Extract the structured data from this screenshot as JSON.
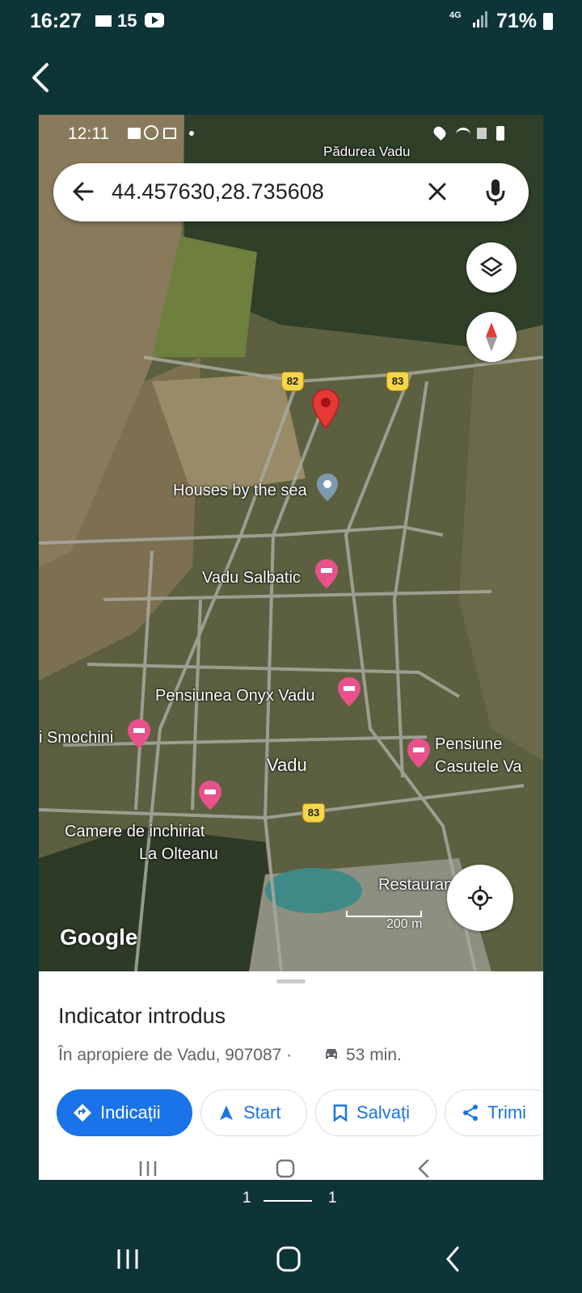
{
  "outer_status": {
    "time": "16:27",
    "temp": "15",
    "network": "4G",
    "battery": "71%"
  },
  "inner_status": {
    "time": "12:11"
  },
  "search": {
    "query": "44.457630,28.735608"
  },
  "map": {
    "labels": {
      "forest": "Pădurea Vadu",
      "houses": "Houses by the sea",
      "salbatic": "Vadu Salbatic",
      "onyx": "Pensiunea Onyx Vadu",
      "smochini": "i Smochini",
      "vadu": "Vadu",
      "casutele_1": "Pensiune",
      "casutele_2": "Casutele Va",
      "camere_1": "Camere de inchiriat",
      "camere_2": "La Olteanu",
      "restaurant": "Restaurant Oass"
    },
    "roads": {
      "r82": "82",
      "r83a": "83",
      "r83b": "83"
    },
    "scale": "200 m",
    "logo": "Google"
  },
  "sheet": {
    "title": "Indicator introdus",
    "subtitle": "În apropiere de Vadu, 907087 ·",
    "drive_time": "53 min.",
    "buttons": {
      "directions": "Indicații",
      "start": "Start",
      "save": "Salvați",
      "share": "Trimi"
    }
  },
  "pager": {
    "current": "1",
    "total": "1"
  },
  "colors": {
    "accent": "#1a73e8",
    "background": "#0d3537",
    "pin": "#e53935"
  }
}
